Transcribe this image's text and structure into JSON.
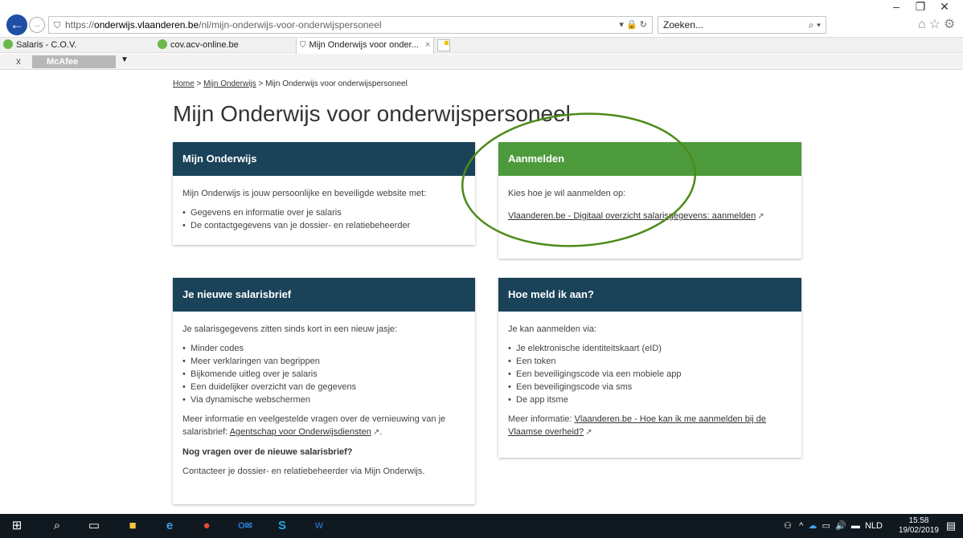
{
  "browser": {
    "url_proto": "https://",
    "url_host": "onderwijs.vlaanderen.be",
    "url_path": "/nl/mijn-onderwijs-voor-onderwijspersoneel",
    "search_placeholder": "Zoeken...",
    "tabs": [
      {
        "label": "Salaris - C.O.V."
      },
      {
        "label": "cov.acv-online.be"
      },
      {
        "label": "Mijn Onderwijs voor onder...",
        "close": "×"
      }
    ],
    "toolbar": {
      "close": "x",
      "mcafee_label": "McAfee",
      "caret": "▼"
    }
  },
  "page": {
    "breadcrumb": {
      "home": "Home",
      "sep1": ">",
      "mijn_onderwijs": "Mijn Onderwijs",
      "sep2": ">",
      "current": "Mijn Onderwijs voor onderwijspersoneel"
    },
    "title": "Mijn Onderwijs voor onderwijspersoneel",
    "cards": {
      "mijn_onderwijs": {
        "header": "Mijn Onderwijs",
        "intro": "Mijn Onderwijs is jouw persoonlijke en beveiligde website met:",
        "items": [
          "Gegevens en informatie over je salaris",
          "De contactgegevens van je dossier- en relatiebeheerder"
        ]
      },
      "aanmelden": {
        "header": "Aanmelden",
        "intro": "Kies hoe je wil aanmelden op:",
        "link": "Vlaanderen.be - Digitaal overzicht salarisgegevens: aanmelden"
      },
      "salarisbrief": {
        "header": "Je nieuwe salarisbrief",
        "intro": "Je salarisgegevens zitten sinds kort in een nieuw jasje:",
        "items": [
          "Minder codes",
          "Meer verklaringen van begrippen",
          "Bijkomende uitleg over je salaris",
          "Een duidelijker overzicht van de gegevens",
          "Via dynamische webschermen"
        ],
        "more_text": "Meer informatie en veelgestelde vragen over de vernieuwing van je salarisbrief:",
        "more_link": "Agentschap voor Onderwijsdiensten",
        "more_end": ".",
        "question": "Nog vragen over de nieuwe salarisbrief?",
        "contact": "Contacteer je dossier- en relatiebeheerder via Mijn Onderwijs."
      },
      "hoe_meld": {
        "header": "Hoe meld ik aan?",
        "intro": "Je kan aanmelden via:",
        "items": [
          "Je elektronische identiteitskaart (eID)",
          "Een token",
          "Een beveiligingscode via een mobiele app",
          "Een beveiligingscode via sms",
          "De app itsme"
        ],
        "more_text": "Meer informatie:",
        "more_link": "Vlaanderen.be - Hoe kan ik me aanmelden bij de Vlaamse overheid?"
      }
    }
  },
  "taskbar": {
    "tray_lang": "NLD",
    "time": "15:58",
    "date": "19/02/2019"
  },
  "colors": {
    "card_header_dark": "#1a4258",
    "card_header_green": "#4d9a3c",
    "annotation_ellipse": "#4d8a1a",
    "taskbar": "#101820"
  },
  "icons": [
    "back-arrow-icon",
    "forward-arrow-icon",
    "site-icon",
    "lock-icon",
    "refresh-icon",
    "search-icon",
    "home-icon",
    "star-icon",
    "gear-icon",
    "external-link-icon",
    "windows-start-icon",
    "cortana-search-icon",
    "task-view-icon",
    "file-explorer-icon",
    "edge-icon",
    "chrome-icon",
    "outlook-icon",
    "skype-icon",
    "word-icon"
  ]
}
